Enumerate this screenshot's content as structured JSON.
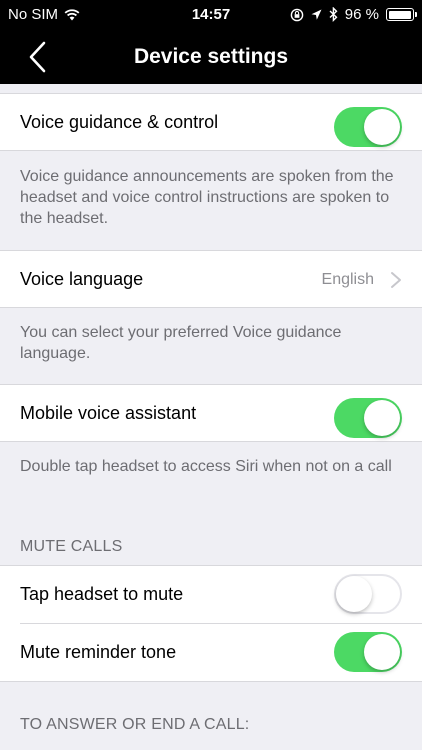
{
  "status_bar": {
    "carrier": "No SIM",
    "time": "14:57",
    "battery_percent": "96 %",
    "battery_level": 0.96,
    "icons": [
      "wifi-icon",
      "rotation-lock-icon",
      "location-icon",
      "bluetooth-icon",
      "battery-icon"
    ]
  },
  "nav": {
    "title": "Device settings",
    "back_icon": "chevron-left-icon"
  },
  "settings": {
    "voice_guidance": {
      "label": "Voice guidance & control",
      "on": true
    },
    "voice_guidance_note": "Voice guidance announcements are spoken from the headset and voice control instructions are spoken to the headset.",
    "voice_language": {
      "label": "Voice language",
      "value": "English"
    },
    "voice_language_note": "You can select your preferred Voice guidance language.",
    "mobile_assistant": {
      "label": "Mobile voice assistant",
      "on": true
    },
    "mobile_assistant_note": "Double tap headset to access Siri when not on a call",
    "mute_calls_header": "MUTE CALLS",
    "tap_to_mute": {
      "label": "Tap headset to mute",
      "on": false
    },
    "mute_reminder": {
      "label": "Mute reminder tone",
      "on": true
    },
    "answer_end_header": "TO ANSWER OR END A CALL:"
  },
  "colors": {
    "toggle_on": "#4cd964",
    "background": "#efeff4",
    "bar": "#000000"
  }
}
